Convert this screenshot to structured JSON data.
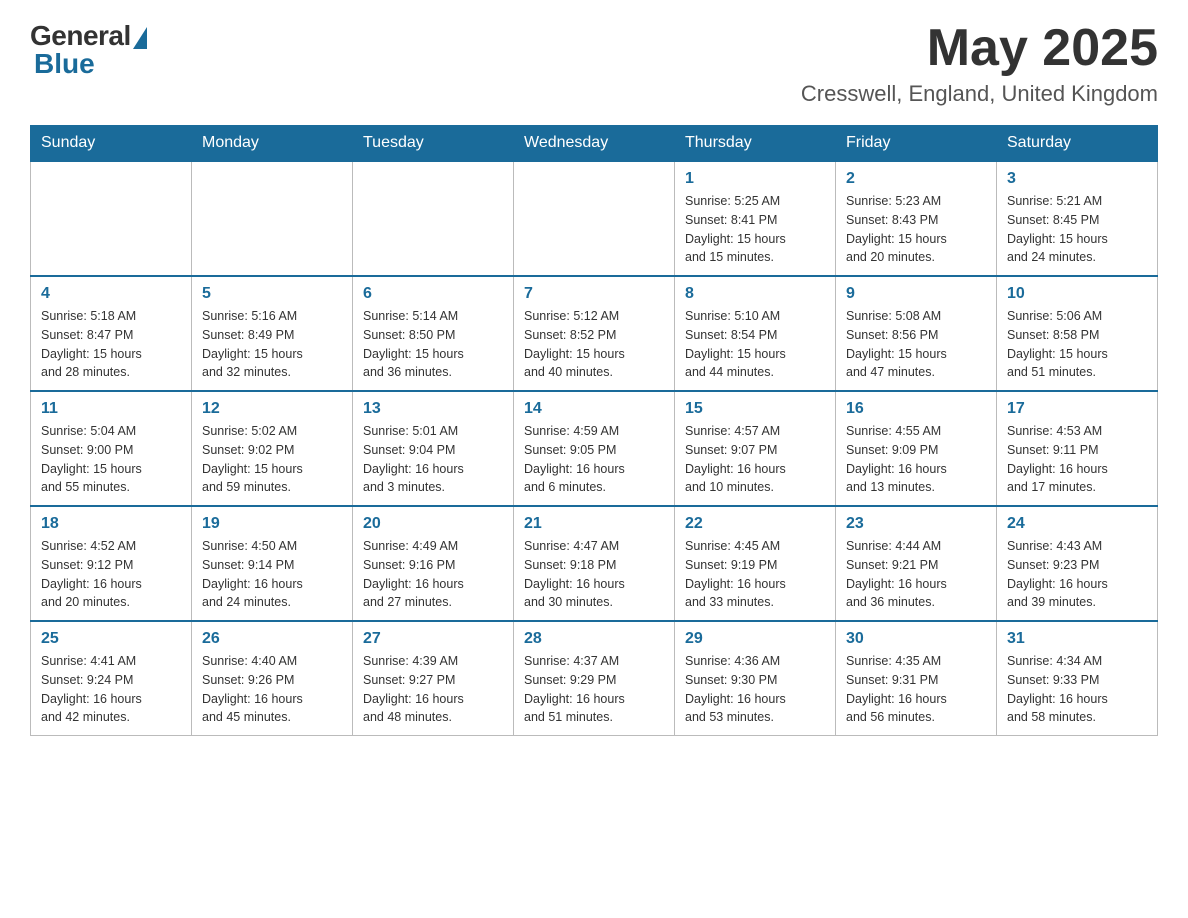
{
  "header": {
    "logo_general": "General",
    "logo_blue": "Blue",
    "month": "May 2025",
    "location": "Cresswell, England, United Kingdom"
  },
  "weekdays": [
    "Sunday",
    "Monday",
    "Tuesday",
    "Wednesday",
    "Thursday",
    "Friday",
    "Saturday"
  ],
  "weeks": [
    [
      {
        "day": "",
        "info": ""
      },
      {
        "day": "",
        "info": ""
      },
      {
        "day": "",
        "info": ""
      },
      {
        "day": "",
        "info": ""
      },
      {
        "day": "1",
        "info": "Sunrise: 5:25 AM\nSunset: 8:41 PM\nDaylight: 15 hours\nand 15 minutes."
      },
      {
        "day": "2",
        "info": "Sunrise: 5:23 AM\nSunset: 8:43 PM\nDaylight: 15 hours\nand 20 minutes."
      },
      {
        "day": "3",
        "info": "Sunrise: 5:21 AM\nSunset: 8:45 PM\nDaylight: 15 hours\nand 24 minutes."
      }
    ],
    [
      {
        "day": "4",
        "info": "Sunrise: 5:18 AM\nSunset: 8:47 PM\nDaylight: 15 hours\nand 28 minutes."
      },
      {
        "day": "5",
        "info": "Sunrise: 5:16 AM\nSunset: 8:49 PM\nDaylight: 15 hours\nand 32 minutes."
      },
      {
        "day": "6",
        "info": "Sunrise: 5:14 AM\nSunset: 8:50 PM\nDaylight: 15 hours\nand 36 minutes."
      },
      {
        "day": "7",
        "info": "Sunrise: 5:12 AM\nSunset: 8:52 PM\nDaylight: 15 hours\nand 40 minutes."
      },
      {
        "day": "8",
        "info": "Sunrise: 5:10 AM\nSunset: 8:54 PM\nDaylight: 15 hours\nand 44 minutes."
      },
      {
        "day": "9",
        "info": "Sunrise: 5:08 AM\nSunset: 8:56 PM\nDaylight: 15 hours\nand 47 minutes."
      },
      {
        "day": "10",
        "info": "Sunrise: 5:06 AM\nSunset: 8:58 PM\nDaylight: 15 hours\nand 51 minutes."
      }
    ],
    [
      {
        "day": "11",
        "info": "Sunrise: 5:04 AM\nSunset: 9:00 PM\nDaylight: 15 hours\nand 55 minutes."
      },
      {
        "day": "12",
        "info": "Sunrise: 5:02 AM\nSunset: 9:02 PM\nDaylight: 15 hours\nand 59 minutes."
      },
      {
        "day": "13",
        "info": "Sunrise: 5:01 AM\nSunset: 9:04 PM\nDaylight: 16 hours\nand 3 minutes."
      },
      {
        "day": "14",
        "info": "Sunrise: 4:59 AM\nSunset: 9:05 PM\nDaylight: 16 hours\nand 6 minutes."
      },
      {
        "day": "15",
        "info": "Sunrise: 4:57 AM\nSunset: 9:07 PM\nDaylight: 16 hours\nand 10 minutes."
      },
      {
        "day": "16",
        "info": "Sunrise: 4:55 AM\nSunset: 9:09 PM\nDaylight: 16 hours\nand 13 minutes."
      },
      {
        "day": "17",
        "info": "Sunrise: 4:53 AM\nSunset: 9:11 PM\nDaylight: 16 hours\nand 17 minutes."
      }
    ],
    [
      {
        "day": "18",
        "info": "Sunrise: 4:52 AM\nSunset: 9:12 PM\nDaylight: 16 hours\nand 20 minutes."
      },
      {
        "day": "19",
        "info": "Sunrise: 4:50 AM\nSunset: 9:14 PM\nDaylight: 16 hours\nand 24 minutes."
      },
      {
        "day": "20",
        "info": "Sunrise: 4:49 AM\nSunset: 9:16 PM\nDaylight: 16 hours\nand 27 minutes."
      },
      {
        "day": "21",
        "info": "Sunrise: 4:47 AM\nSunset: 9:18 PM\nDaylight: 16 hours\nand 30 minutes."
      },
      {
        "day": "22",
        "info": "Sunrise: 4:45 AM\nSunset: 9:19 PM\nDaylight: 16 hours\nand 33 minutes."
      },
      {
        "day": "23",
        "info": "Sunrise: 4:44 AM\nSunset: 9:21 PM\nDaylight: 16 hours\nand 36 minutes."
      },
      {
        "day": "24",
        "info": "Sunrise: 4:43 AM\nSunset: 9:23 PM\nDaylight: 16 hours\nand 39 minutes."
      }
    ],
    [
      {
        "day": "25",
        "info": "Sunrise: 4:41 AM\nSunset: 9:24 PM\nDaylight: 16 hours\nand 42 minutes."
      },
      {
        "day": "26",
        "info": "Sunrise: 4:40 AM\nSunset: 9:26 PM\nDaylight: 16 hours\nand 45 minutes."
      },
      {
        "day": "27",
        "info": "Sunrise: 4:39 AM\nSunset: 9:27 PM\nDaylight: 16 hours\nand 48 minutes."
      },
      {
        "day": "28",
        "info": "Sunrise: 4:37 AM\nSunset: 9:29 PM\nDaylight: 16 hours\nand 51 minutes."
      },
      {
        "day": "29",
        "info": "Sunrise: 4:36 AM\nSunset: 9:30 PM\nDaylight: 16 hours\nand 53 minutes."
      },
      {
        "day": "30",
        "info": "Sunrise: 4:35 AM\nSunset: 9:31 PM\nDaylight: 16 hours\nand 56 minutes."
      },
      {
        "day": "31",
        "info": "Sunrise: 4:34 AM\nSunset: 9:33 PM\nDaylight: 16 hours\nand 58 minutes."
      }
    ]
  ]
}
